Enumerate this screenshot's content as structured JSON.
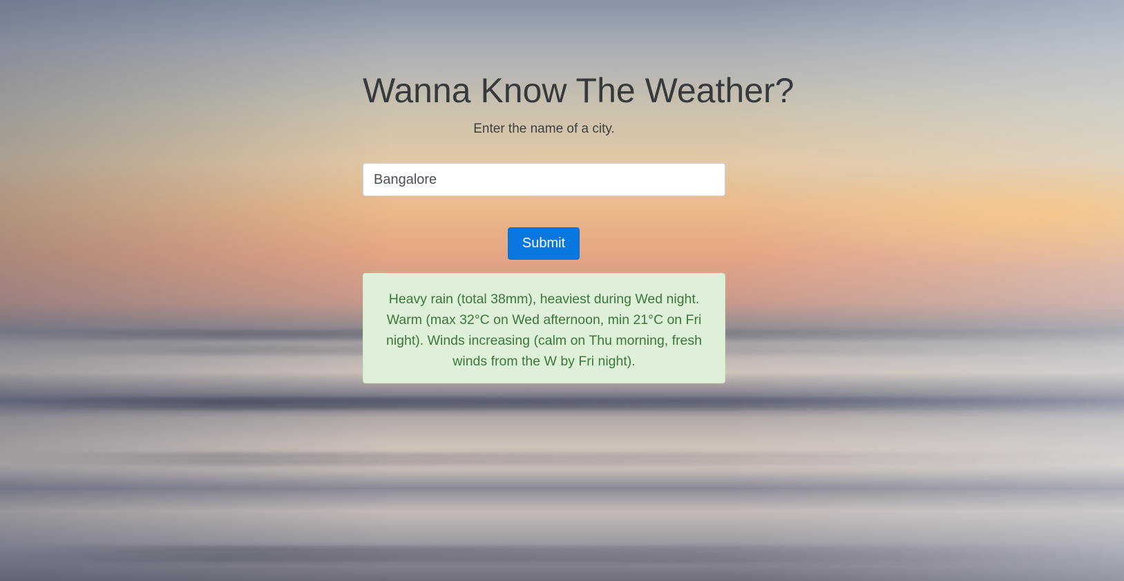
{
  "page": {
    "title": "Wanna Know The Weather?",
    "subtitle": "Enter the name of a city."
  },
  "form": {
    "city_value": "Bangalore",
    "submit_label": "Submit"
  },
  "result": {
    "text": "Heavy rain (total 38mm), heaviest during Wed night. Warm (max 32°C on Wed afternoon, min 21°C on Fri night). Winds increasing (calm on Thu morning, fresh winds from the W by Fri night)."
  },
  "colors": {
    "accent": "#0a77e0",
    "success_bg": "#dff0d8",
    "success_text": "#3c763d"
  }
}
